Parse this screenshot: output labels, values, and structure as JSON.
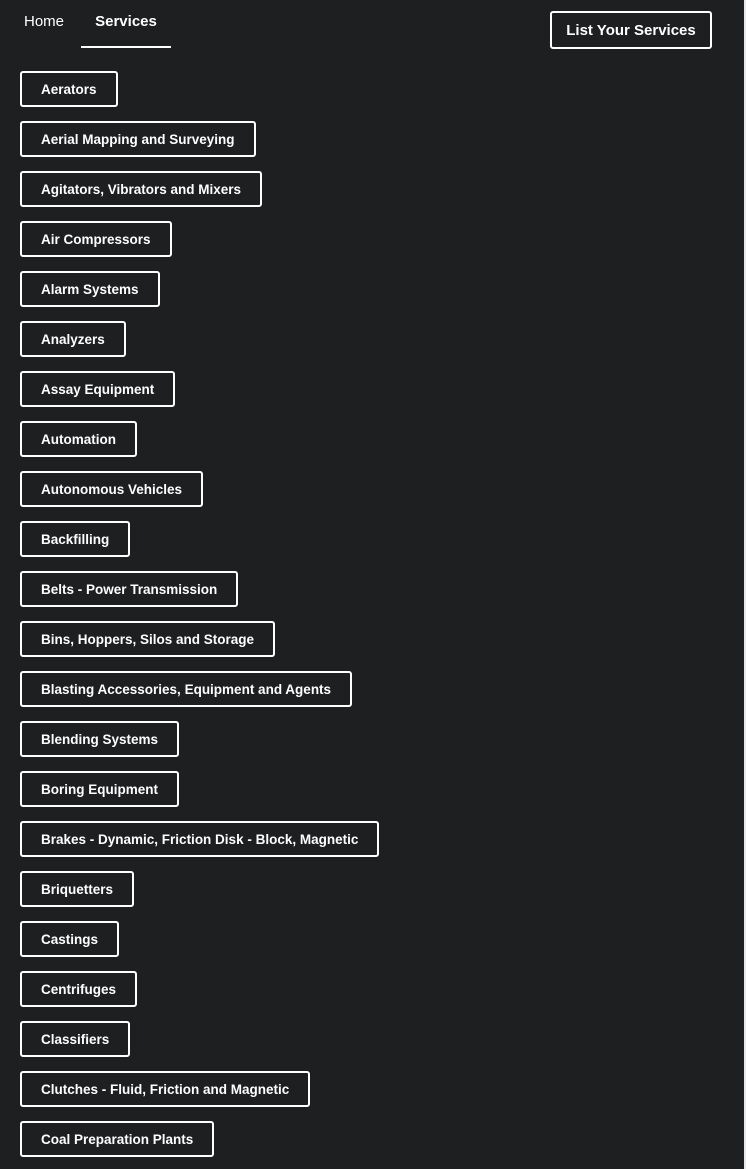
{
  "nav": {
    "tabs": [
      {
        "label": "Home",
        "active": false
      },
      {
        "label": "Services",
        "active": true
      }
    ],
    "cta_label": "List Your Services"
  },
  "services": [
    "Aerators",
    "Aerial Mapping and Surveying",
    "Agitators, Vibrators and Mixers",
    "Air Compressors",
    "Alarm Systems",
    "Analyzers",
    "Assay Equipment",
    "Automation",
    "Autonomous Vehicles",
    "Backfilling",
    "Belts - Power Transmission",
    "Bins, Hoppers, Silos and Storage",
    "Blasting Accessories, Equipment and Agents",
    "Blending Systems",
    "Boring Equipment",
    "Brakes - Dynamic, Friction Disk - Block, Magnetic",
    "Briquetters",
    "Castings",
    "Centrifuges",
    "Classifiers",
    "Clutches - Fluid, Friction and Magnetic",
    "Coal Preparation Plants"
  ],
  "colors": {
    "background": "#1e1f21",
    "foreground": "#ffffff"
  }
}
